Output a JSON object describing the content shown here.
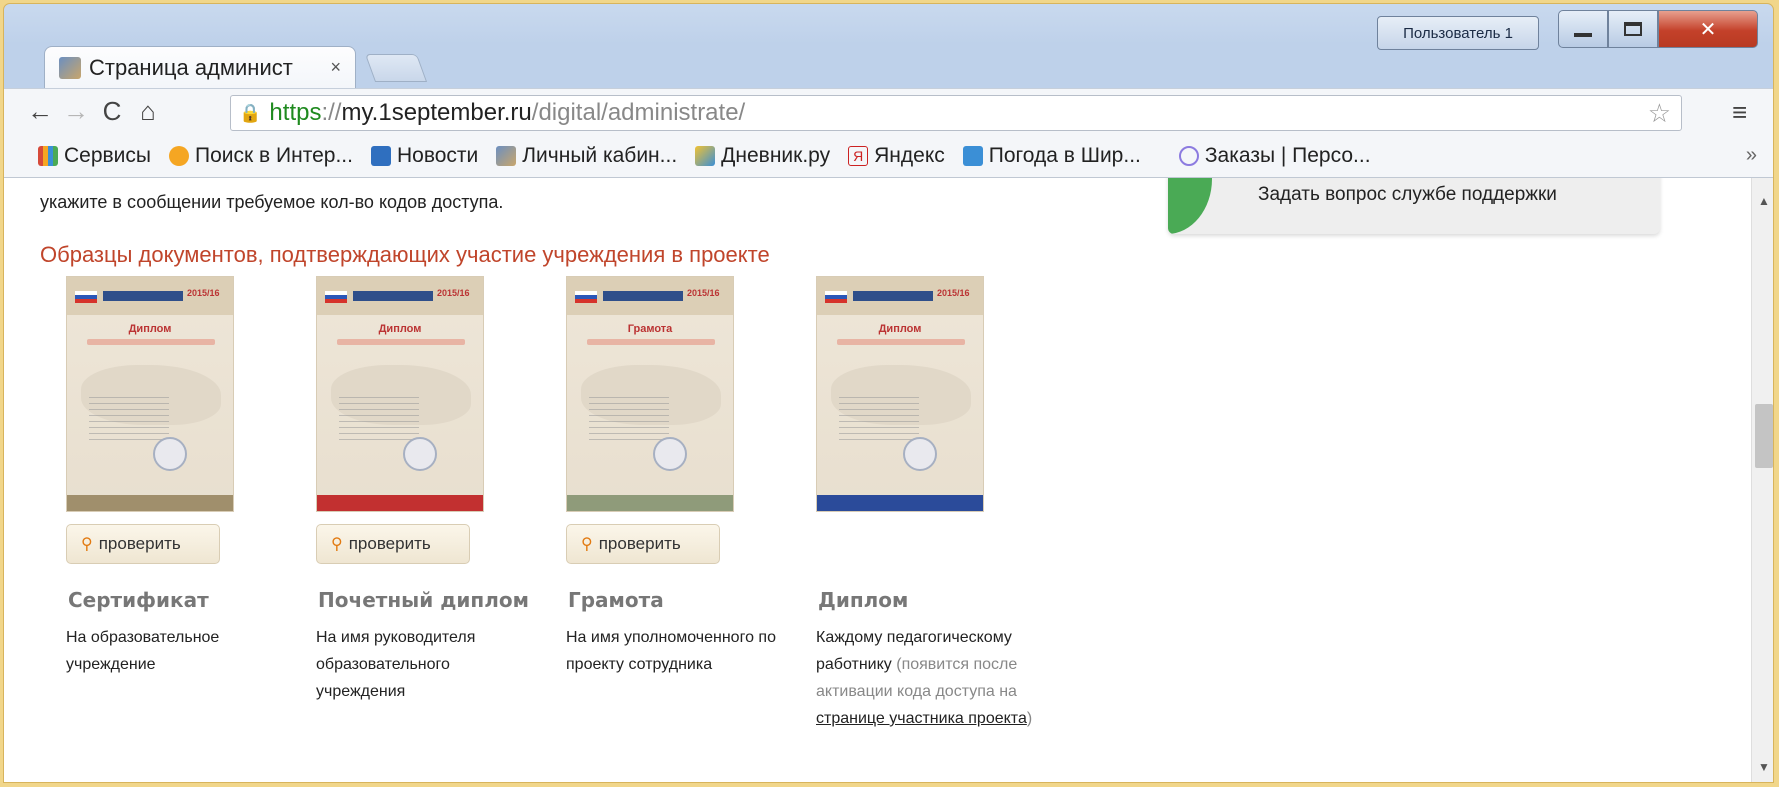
{
  "browser": {
    "tab_title": "Страница админист",
    "tab_close": "×",
    "user_button": "Пользователь 1",
    "url": {
      "scheme": "https",
      "sep": "://",
      "host": "my.1september.ru",
      "path": "/digital/administrate/"
    },
    "bookmarks": [
      {
        "label": "Сервисы",
        "color": "#d64a3a"
      },
      {
        "label": "Поиск в Интер...",
        "color": "#f5a623"
      },
      {
        "label": "Новости",
        "color": "#2f6fbf"
      },
      {
        "label": "Личный кабин...",
        "color": "#8d7b5a"
      },
      {
        "label": "Дневник.ру",
        "color": "#f1c232"
      },
      {
        "label": "Яндекс",
        "color": "#cc2222"
      },
      {
        "label": "Погода в Шир...",
        "color": "#3b8fd6"
      },
      {
        "label": "Заказы | Персо...",
        "color": "#8c7be0"
      }
    ],
    "bookmarks_more": "»"
  },
  "page": {
    "intro_line": "укажите в сообщении требуемое кол-во кодов доступа.",
    "support_widget": "Задать вопрос службе поддержки",
    "section_title": "Образцы документов, подтверждающих участие учреждения в проекте",
    "check_label": "проверить",
    "documents": [
      {
        "thumb_title": "Диплом",
        "foot_color": "#a08f6c",
        "has_check": true,
        "name": "Сертификат",
        "desc": "На образовательное учреждение"
      },
      {
        "thumb_title": "Диплом",
        "foot_color": "#c23030",
        "has_check": true,
        "name": "Почетный диплом",
        "desc": "На имя руководителя образовательного учреждения"
      },
      {
        "thumb_title": "Грамота",
        "foot_color": "#8f9b7a",
        "has_check": true,
        "name": "Грамота",
        "desc": "На имя уполномоченного по проекту сотрудника"
      },
      {
        "thumb_title": "Диплом",
        "foot_color": "#2b4b9a",
        "has_check": false,
        "name": "Диплом",
        "desc": "Каждому педагогическому работнику",
        "note_open": " (появится после активации кода доступа на ",
        "note_link": "странице участника проекта",
        "note_close": ")"
      }
    ]
  }
}
